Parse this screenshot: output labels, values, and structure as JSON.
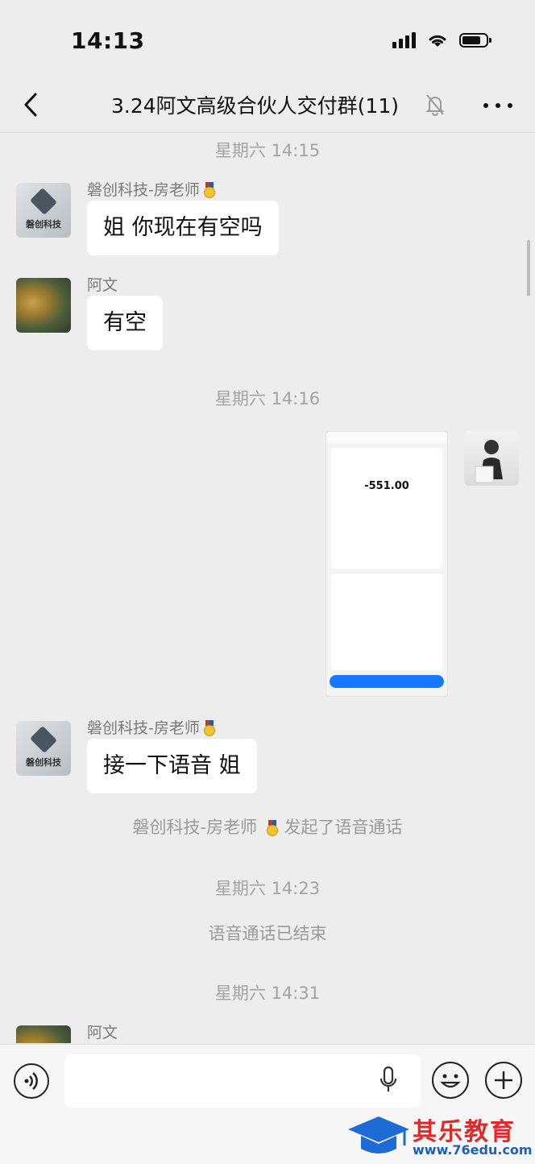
{
  "status_bar": {
    "time": "14:13"
  },
  "nav": {
    "title": "3.24阿文高级合伙人交付群(11)"
  },
  "messages": [
    {
      "type": "timestamp",
      "text": "星期六 14:15"
    },
    {
      "type": "text",
      "sender": "磐创科技-房老师",
      "text": "姐 你现在有空吗",
      "avatar": "brand-avatar"
    },
    {
      "type": "text",
      "sender": "阿文",
      "text": "有空",
      "avatar": "mushroom-avatar"
    },
    {
      "type": "timestamp",
      "text": "星期六 14:16"
    },
    {
      "type": "image",
      "side": "right",
      "amount": "-551.00",
      "avatar": "self-avatar"
    },
    {
      "type": "text",
      "sender": "磐创科技-房老师",
      "text": "接一下语音 姐",
      "avatar": "brand-avatar"
    },
    {
      "type": "system",
      "text_prefix": "磐创科技-房老师",
      "text_suffix": "发起了语音通话"
    },
    {
      "type": "timestamp",
      "text": "星期六 14:23"
    },
    {
      "type": "system",
      "text": "语音通话已结束"
    },
    {
      "type": "timestamp",
      "text": "星期六 14:31"
    },
    {
      "type": "text",
      "sender": "阿文",
      "text": "",
      "avatar": "mushroom-avatar"
    }
  ],
  "brand_avatar_text": "磐创科技",
  "input": {
    "value": "",
    "placeholder": ""
  },
  "watermark": {
    "title": "其乐教育",
    "url": "www.76edu.com"
  },
  "colors": {
    "background": "#ededed",
    "bubble": "#ffffff",
    "accent_blue": "#1677ff",
    "watermark_red": "#e02a2a"
  }
}
